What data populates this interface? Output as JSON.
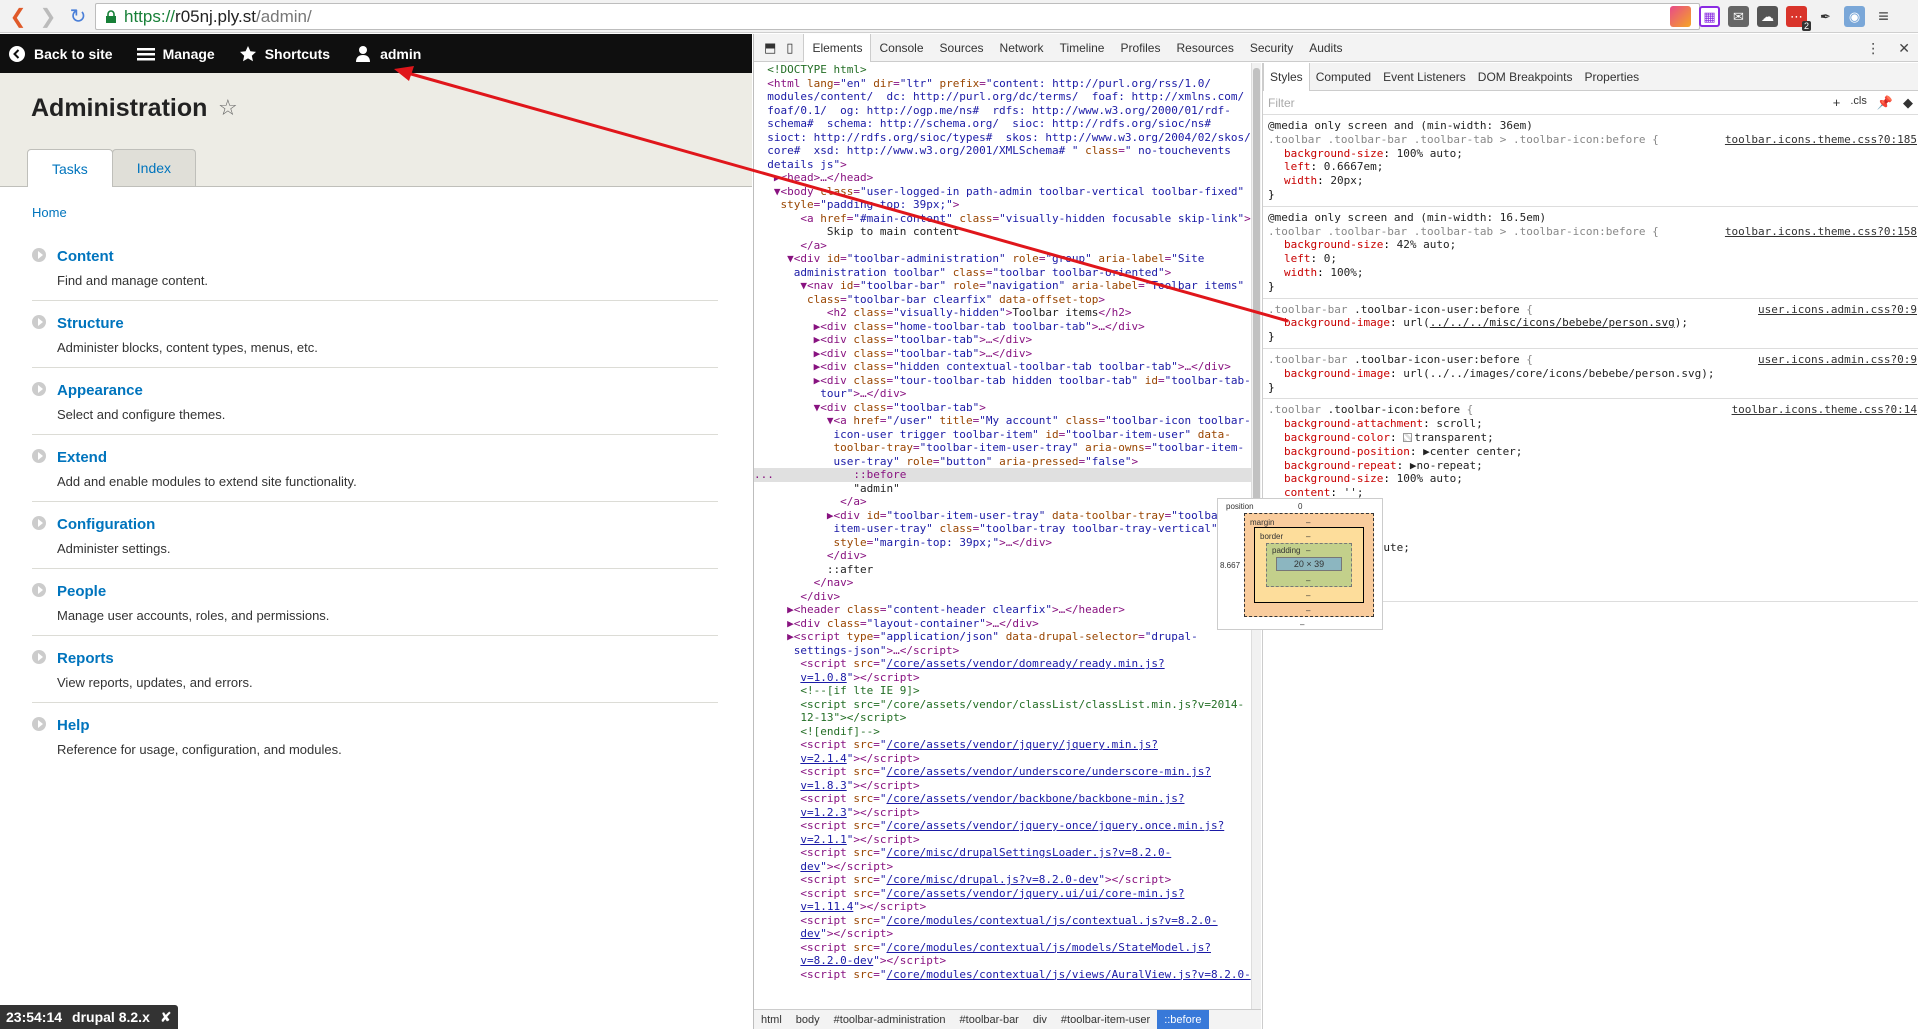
{
  "browser": {
    "url_scheme": "https://",
    "url_host": "r05nj.ply.st",
    "url_path": "/admin/",
    "ext_badge": "2"
  },
  "toolbar": {
    "back": "Back to site",
    "manage": "Manage",
    "shortcuts": "Shortcuts",
    "user": "admin"
  },
  "header": {
    "title": "Administration",
    "tabs": [
      "Tasks",
      "Index"
    ]
  },
  "breadcrumb": "Home",
  "admin_items": [
    {
      "title": "Content",
      "desc": "Find and manage content."
    },
    {
      "title": "Structure",
      "desc": "Administer blocks, content types, menus, etc."
    },
    {
      "title": "Appearance",
      "desc": "Select and configure themes."
    },
    {
      "title": "Extend",
      "desc": "Add and enable modules to extend site functionality."
    },
    {
      "title": "Configuration",
      "desc": "Administer settings."
    },
    {
      "title": "People",
      "desc": "Manage user accounts, roles, and permissions."
    },
    {
      "title": "Reports",
      "desc": "View reports, updates, and errors."
    },
    {
      "title": "Help",
      "desc": "Reference for usage, configuration, and modules."
    }
  ],
  "status": {
    "time": "23:54:14",
    "label": "drupal 8.2.x",
    "close": "✘"
  },
  "devtools": {
    "tabs": [
      "Elements",
      "Console",
      "Sources",
      "Network",
      "Timeline",
      "Profiles",
      "Resources",
      "Security",
      "Audits"
    ],
    "styles_tabs": [
      "Styles",
      "Computed",
      "Event Listeners",
      "DOM Breakpoints",
      "Properties"
    ],
    "filter_placeholder": "Filter",
    "filter_cls": ".cls",
    "breadcrumbs": [
      "html",
      "body",
      "#toolbar-administration",
      "#toolbar-bar",
      "div",
      "#toolbar-item-user",
      "::before"
    ],
    "boxmodel": {
      "position": "position",
      "position_val": "0",
      "margin": "margin",
      "border": "border",
      "padding": "padding",
      "content": "20 × 39",
      "left_val": "8.667",
      "dash": "–"
    }
  }
}
